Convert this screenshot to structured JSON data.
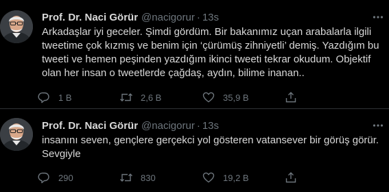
{
  "tweets": [
    {
      "display_name": "Prof. Dr. Naci Görür",
      "handle": "@nacigorur",
      "separator": "·",
      "time": "13s",
      "text": "Arkadaşlar iyi geceler. Şimdi gördüm. Bir bakanımız uçan arabalarla ilgili tweetime çok kızmış ve benim için ‘çürümüş zihniyetli’ demiş. Yazdığım bu tweeti ve hemen peşinden yazdığım ikinci tweeti tekrar okudum. Objektif olan her insan o tweetlerde çağdaş, aydın, bilime inanan..",
      "replies": "1 B",
      "retweets": "2,6 B",
      "likes": "35,9 B"
    },
    {
      "display_name": "Prof. Dr. Naci Görür",
      "handle": "@nacigorur",
      "separator": "·",
      "time": "13s",
      "text": "insanını seven, gençlere gerçekci yol gösteren vatansever bir görüş görür. Sevgiyle",
      "replies": "290",
      "retweets": "830",
      "likes": "19,2 B"
    }
  ],
  "icons": {
    "more": "more-horizontal-icon",
    "reply": "reply-icon",
    "retweet": "retweet-icon",
    "like": "heart-icon",
    "share": "share-icon"
  },
  "colors": {
    "background": "#000000",
    "text": "#d9d9d9",
    "secondary": "#6e767d",
    "divider": "#2f3336"
  }
}
